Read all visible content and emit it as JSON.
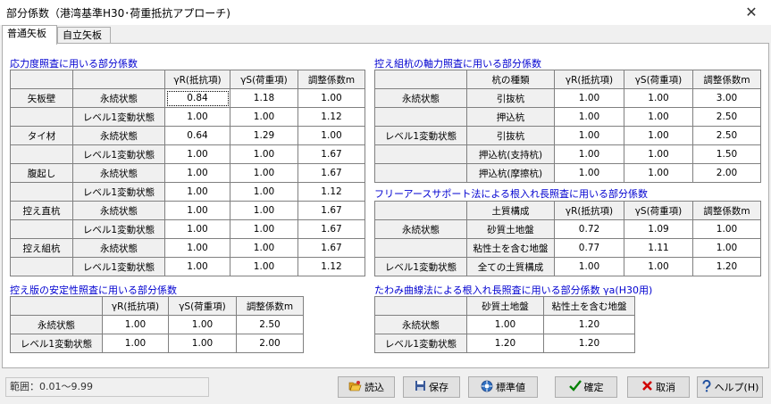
{
  "window": {
    "title": "部分係数（港湾基準H30･荷重抵抗アプローチ)",
    "close_glyph": "✕"
  },
  "tabs": [
    {
      "label": "普通矢板"
    },
    {
      "label": "自立矢板"
    }
  ],
  "stress": {
    "title": "応力度照査に用いる部分係数",
    "headers": [
      "γR(抵抗項)",
      "γS(荷重項)",
      "調整係数m"
    ],
    "members": [
      "矢板壁",
      "タイ材",
      "腹起し",
      "控え直杭",
      "控え組杭"
    ],
    "states": [
      "永続状態",
      "レベル1変動状態"
    ],
    "rows": [
      [
        "0.84",
        "1.18",
        "1.00"
      ],
      [
        "1.00",
        "1.00",
        "1.12"
      ],
      [
        "0.64",
        "1.29",
        "1.00"
      ],
      [
        "1.00",
        "1.00",
        "1.67"
      ],
      [
        "1.00",
        "1.00",
        "1.67"
      ],
      [
        "1.00",
        "1.00",
        "1.12"
      ],
      [
        "1.00",
        "1.00",
        "1.67"
      ],
      [
        "1.00",
        "1.00",
        "1.67"
      ],
      [
        "1.00",
        "1.00",
        "1.67"
      ],
      [
        "1.00",
        "1.00",
        "1.12"
      ]
    ]
  },
  "anchor_plate": {
    "title": "控え版の安定性照査に用いる部分係数",
    "headers": [
      "γR(抵抗項)",
      "γS(荷重項)",
      "調整係数m"
    ],
    "states": [
      "永続状態",
      "レベル1変動状態"
    ],
    "rows": [
      [
        "1.00",
        "1.00",
        "2.50"
      ],
      [
        "1.00",
        "1.00",
        "2.00"
      ]
    ]
  },
  "axial": {
    "title": "控え組杭の軸力照査に用いる部分係数",
    "headers": [
      "杭の種類",
      "γR(抵抗項)",
      "γS(荷重項)",
      "調整係数m"
    ],
    "states": [
      "永続状態",
      "レベル1変動状態"
    ],
    "pile_types": [
      "引抜杭",
      "押込杭",
      "引抜杭",
      "押込杭(支持杭)",
      "押込杭(摩擦杭)"
    ],
    "rows": [
      [
        "1.00",
        "1.00",
        "3.00"
      ],
      [
        "1.00",
        "1.00",
        "2.50"
      ],
      [
        "1.00",
        "1.00",
        "2.50"
      ],
      [
        "1.00",
        "1.00",
        "1.50"
      ],
      [
        "1.00",
        "1.00",
        "2.00"
      ]
    ]
  },
  "free_earth": {
    "title": "フリーアースサポート法による根入れ長照査に用いる部分係数",
    "headers": [
      "土質構成",
      "γR(抵抗項)",
      "γS(荷重項)",
      "調整係数m"
    ],
    "states": [
      "永続状態",
      "レベル1変動状態"
    ],
    "soils": [
      "砂質土地盤",
      "粘性土を含む地盤",
      "全ての土質構成"
    ],
    "rows": [
      [
        "0.72",
        "1.09",
        "1.00"
      ],
      [
        "0.77",
        "1.11",
        "1.00"
      ],
      [
        "1.00",
        "1.00",
        "1.20"
      ]
    ]
  },
  "deflection": {
    "title": "たわみ曲線法による根入れ長照査に用いる部分係数 γa(H30用)",
    "headers": [
      "砂質土地盤",
      "粘性土を含む地盤"
    ],
    "states": [
      "永続状態",
      "レベル1変動状態"
    ],
    "rows": [
      [
        "1.00",
        "1.20"
      ],
      [
        "1.20",
        "1.20"
      ]
    ]
  },
  "footer": {
    "range": "範囲：0.01～9.99",
    "buttons": {
      "load": {
        "label": "読込",
        "icon": "open-folder-icon"
      },
      "save": {
        "label": "保存",
        "icon": "floppy-disk-icon"
      },
      "standard": {
        "label": "標準値",
        "icon": "standard-values-icon"
      },
      "ok": {
        "label": "確定",
        "icon": "check-icon",
        "color": "#008000"
      },
      "cancel": {
        "label": "取消",
        "icon": "x-icon",
        "color": "#d00000"
      },
      "help": {
        "label": "ヘルプ(H)",
        "icon": "question-icon"
      }
    }
  }
}
